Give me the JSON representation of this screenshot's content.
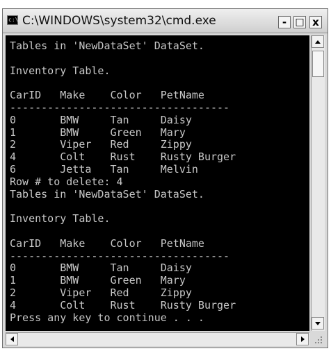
{
  "window": {
    "title": "C:\\WINDOWS\\system32\\cmd.exe",
    "icon_text": "c:\\",
    "controls": {
      "minimize": "-",
      "maximize": "□",
      "close": "x"
    }
  },
  "console": {
    "lines": [
      "Tables in 'NewDataSet' DataSet.",
      "",
      "Inventory Table.",
      "",
      "CarID   Make    Color   PetName",
      "-----------------------------------",
      "0       BMW     Tan     Daisy",
      "1       BMW     Green   Mary",
      "2       Viper   Red     Zippy",
      "4       Colt    Rust    Rusty Burger",
      "6       Jetta   Tan     Melvin",
      "Row # to delete: 4",
      "Tables in 'NewDataSet' DataSet.",
      "",
      "Inventory Table.",
      "",
      "CarID   Make    Color   PetName",
      "-----------------------------------",
      "0       BMW     Tan     Daisy",
      "1       BMW     Green   Mary",
      "2       Viper   Red     Zippy",
      "4       Colt    Rust    Rusty Burger",
      "Press any key to continue . . ."
    ]
  },
  "colors": {
    "console_bg": "#000000",
    "console_text": "#c8c8c8",
    "chrome": "#d9d9d9"
  },
  "icons": [
    "cmd-app-icon",
    "minimize-icon",
    "maximize-icon",
    "close-icon",
    "scroll-up-icon",
    "scroll-down-icon",
    "scroll-left-icon",
    "scroll-right-icon",
    "resize-grip-icon"
  ]
}
